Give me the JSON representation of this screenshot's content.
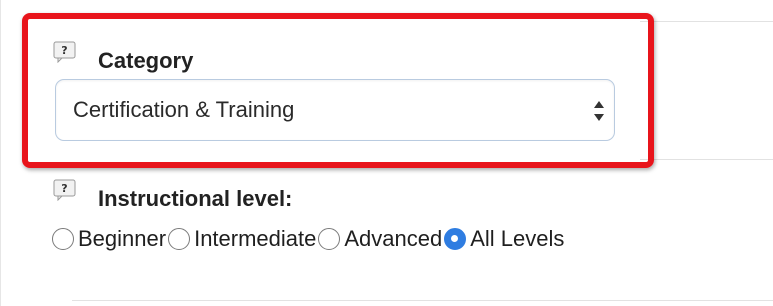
{
  "category": {
    "label": "Category",
    "selected_value": "Certification & Training"
  },
  "instructional_level": {
    "label": "Instructional level:",
    "options": [
      {
        "label": "Beginner",
        "checked": false
      },
      {
        "label": "Intermediate",
        "checked": false
      },
      {
        "label": "Advanced",
        "checked": false
      },
      {
        "label": "All Levels",
        "checked": true
      }
    ]
  },
  "colors": {
    "highlight": "#e8141b",
    "radio_selected": "#2f7de1"
  },
  "icons": {
    "help": "question-mark-speech-icon",
    "select": "updown-arrows-icon"
  }
}
